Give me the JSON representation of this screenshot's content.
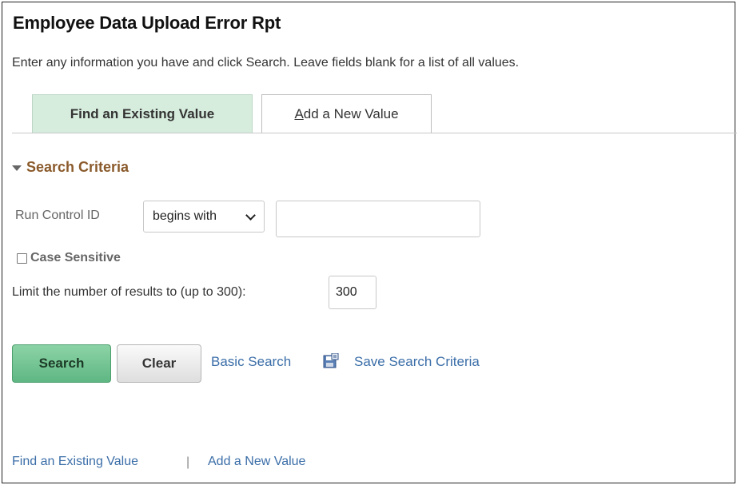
{
  "page": {
    "title": "Employee Data Upload Error Rpt",
    "instructions": "Enter any information you have and click Search. Leave fields blank for a list of all values."
  },
  "tabs": [
    {
      "label": "Find an Existing Value",
      "active": true
    },
    {
      "label_prefix": "A",
      "label_rest": "dd a New Value",
      "active": false
    }
  ],
  "search_criteria": {
    "header": "Search Criteria",
    "run_control_label": "Run Control ID",
    "operator_value": "begins with",
    "run_control_value": "",
    "case_sensitive_label": "Case Sensitive",
    "case_sensitive_checked": false,
    "limit_label": "Limit the number of results to (up to 300):",
    "limit_value": "300"
  },
  "actions": {
    "search_label": "Search",
    "clear_label": "Clear",
    "basic_search_label": "Basic Search",
    "save_criteria_icon": "save-search-icon",
    "save_criteria_label": "Save Search Criteria"
  },
  "footer": {
    "find_existing_label": "Find an Existing Value",
    "separator": "|",
    "add_new_label": "Add a New Value"
  },
  "colors": {
    "active_tab_bg": "#d6ecdd",
    "search_button": "#6cc191",
    "section_header": "#8a5a2b",
    "link": "#3b6ea8"
  }
}
